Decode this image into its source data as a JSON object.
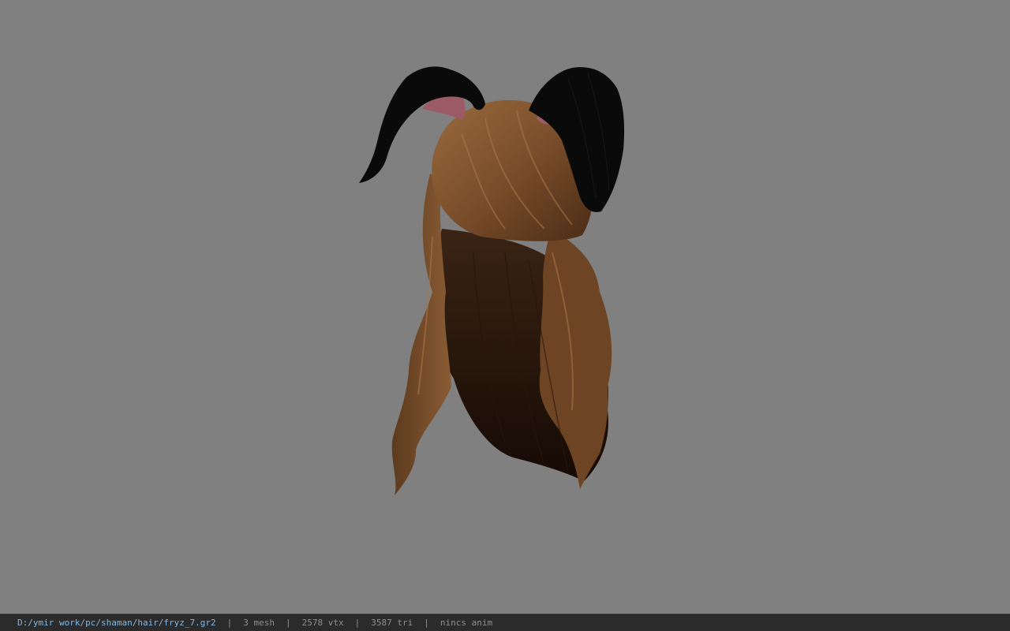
{
  "viewport": {
    "background_color": "#808080",
    "model": {
      "description_icon": "hair-model-icon",
      "hair_color": "#7a4e2a",
      "ear_color": "#0a0a0a",
      "ear_inner_color": "#9b5a66"
    }
  },
  "statusbar": {
    "file_path": "D:/ymir work/pc/shaman/hair/fryz_7.gr2",
    "separator": "|",
    "mesh": "3 mesh",
    "vertices": "2578 vtx",
    "triangles": "3587 tri",
    "anim": "nincs anim",
    "path_color": "#7fb8e6"
  }
}
